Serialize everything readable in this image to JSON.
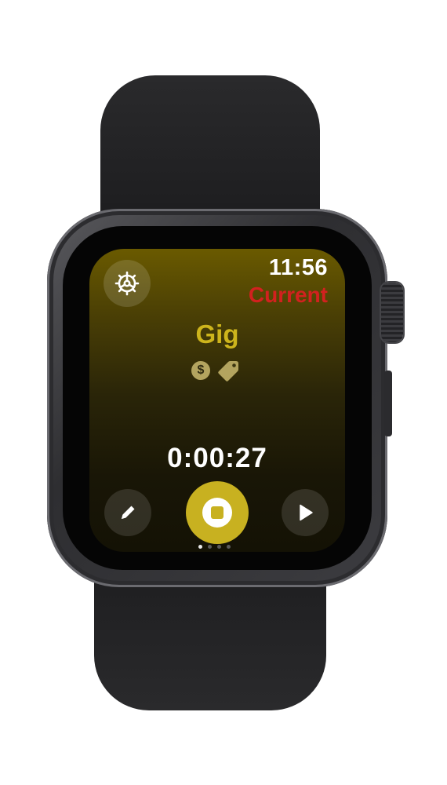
{
  "status_bar": {
    "time": "11:56",
    "status_label": "Current"
  },
  "activity": {
    "title": "Gig",
    "tag_icons": [
      "dollar-icon",
      "tag-icon"
    ],
    "dollar_symbol": "$"
  },
  "timer": {
    "elapsed": "0:00:27"
  },
  "controls": {
    "left": "pencil-icon",
    "center": "stop-icon",
    "right": "play-icon"
  },
  "pagination": {
    "page_count": 4,
    "current_page": 1
  },
  "colors": {
    "accent": "#c8b120",
    "status_red": "#d2211f",
    "background_top": "#6a5a00",
    "background_bottom": "#141205"
  }
}
